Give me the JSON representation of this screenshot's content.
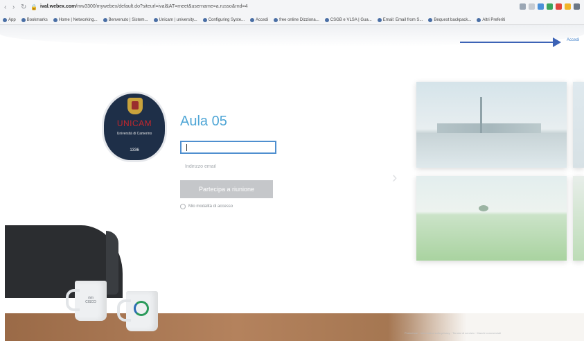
{
  "browser": {
    "url_host": "ival.webex.com",
    "url_rest": "/mw3300/mywebex/default.do?siteurl=ival&AT=meet&username=a.russo&rnd=4",
    "bookmarks": [
      "App",
      "Bookmarks",
      "Home | Networking...",
      "Benvenuto | Sistem...",
      "Unicam | university...",
      "Configuring Syste...",
      "Accedi",
      "free online Dizziona...",
      "CSGB e VLSA | Gua...",
      "Email: Email from S...",
      "Bequest backpack...",
      "Altri Preferiti"
    ]
  },
  "header": {
    "signin_label": "Accedi"
  },
  "logo": {
    "name": "UNICAM",
    "subtitle": "Università di Camerino",
    "year": "1336"
  },
  "meeting": {
    "title": "Aula 05",
    "name_placeholder": "",
    "email_placeholder": "Indirizzo email",
    "join_label": "Partecipa a riunione",
    "remember_label": "Mio modalità di accesso"
  },
  "footer_text": "Protezione · Informativa sulla privacy · Termini di servizio · Marchi commerciali"
}
